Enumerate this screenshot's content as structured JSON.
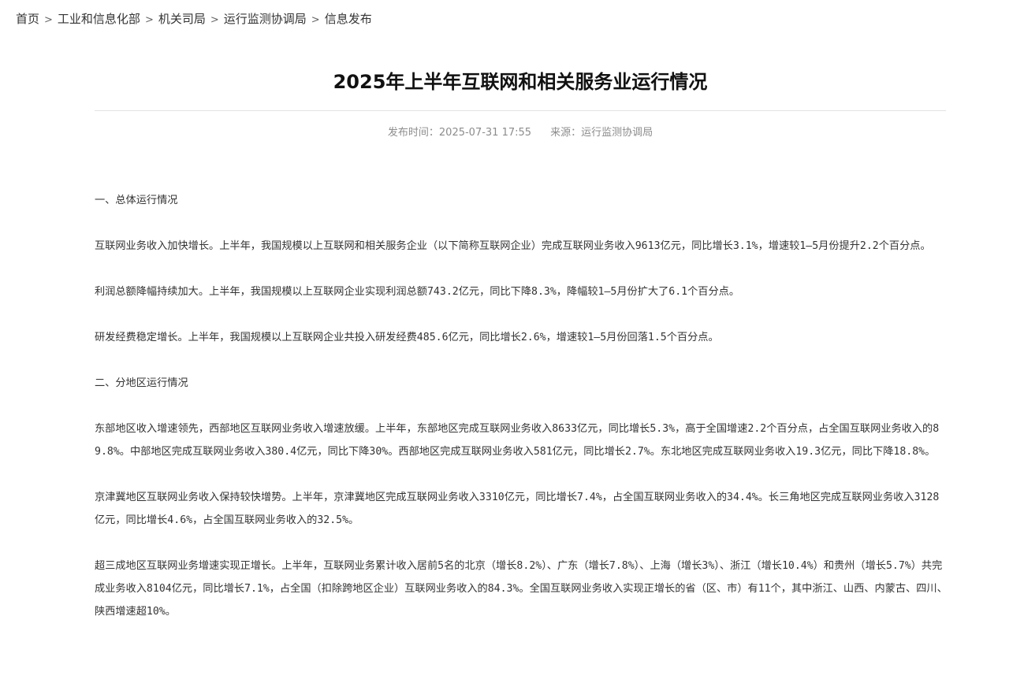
{
  "breadcrumb": {
    "items": [
      "首页",
      "工业和信息化部",
      "机关司局",
      "运行监测协调局",
      "信息发布"
    ],
    "separator": ">"
  },
  "article": {
    "title": "2025年上半年互联网和相关服务业运行情况",
    "publish_label": "发布时间：",
    "publish_time": "2025-07-31 17:55",
    "source_label": "来源：",
    "source": "运行监测协调局",
    "paragraphs": [
      "一、总体运行情况",
      "互联网业务收入加快增长。上半年，我国规模以上互联网和相关服务企业（以下简称互联网企业）完成互联网业务收入9613亿元，同比增长3.1%，增速较1—5月份提升2.2个百分点。",
      "利润总额降幅持续加大。上半年，我国规模以上互联网企业实现利润总额743.2亿元，同比下降8.3%，降幅较1—5月份扩大了6.1个百分点。",
      "研发经费稳定增长。上半年，我国规模以上互联网企业共投入研发经费485.6亿元，同比增长2.6%，增速较1—5月份回落1.5个百分点。",
      "二、分地区运行情况",
      "东部地区收入增速领先，西部地区互联网业务收入增速放缓。上半年，东部地区完成互联网业务收入8633亿元，同比增长5.3%，高于全国增速2.2个百分点，占全国互联网业务收入的89.8%。中部地区完成互联网业务收入380.4亿元，同比下降30%。西部地区完成互联网业务收入581亿元，同比增长2.7%。东北地区完成互联网业务收入19.3亿元，同比下降18.8%。",
      "京津冀地区互联网业务收入保持较快增势。上半年，京津冀地区完成互联网业务收入3310亿元，同比增长7.4%，占全国互联网业务收入的34.4%。长三角地区完成互联网业务收入3128亿元，同比增长4.6%，占全国互联网业务收入的32.5%。",
      "超三成地区互联网业务增速实现正增长。上半年，互联网业务累计收入居前5名的北京（增长8.2%）、广东（增长7.8%）、上海（增长3%）、浙江（增长10.4%）和贵州（增长5.7%）共完成业务收入8104亿元，同比增长7.1%，占全国（扣除跨地区企业）互联网业务收入的84.3%。全国互联网业务收入实现正增长的省（区、市）有11个，其中浙江、山西、内蒙古、四川、陕西增速超10%。"
    ]
  }
}
